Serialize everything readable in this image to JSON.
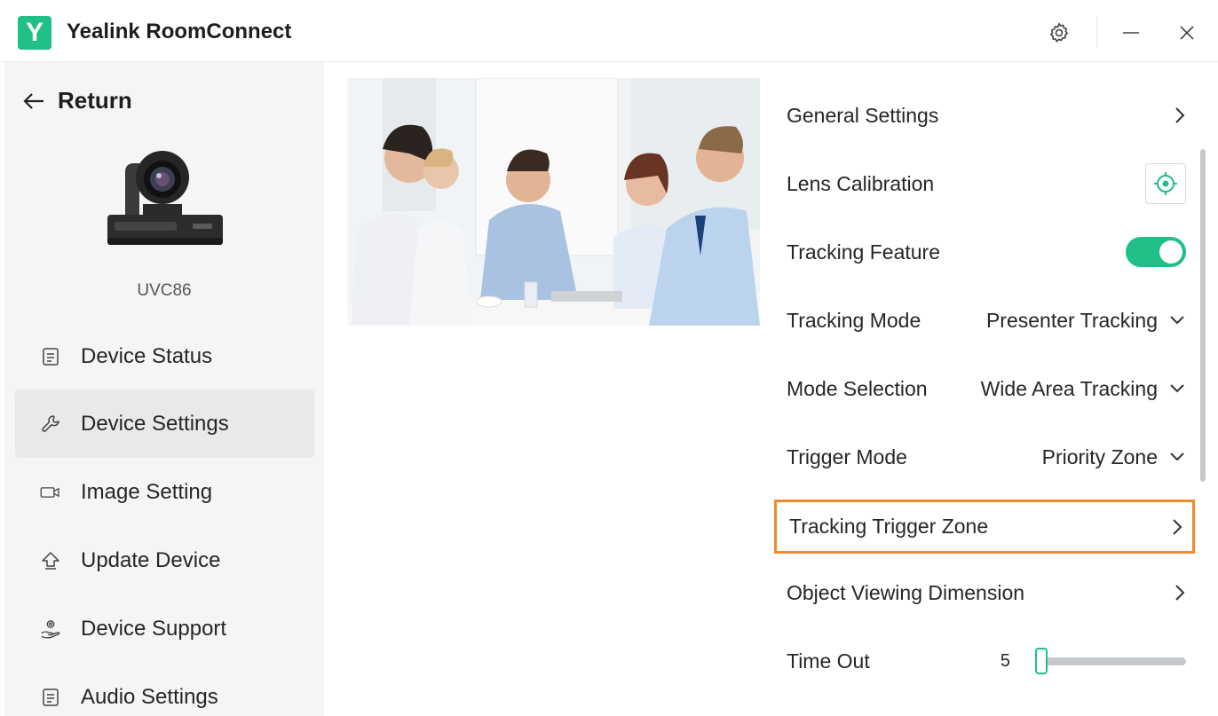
{
  "app": {
    "logo_letter": "Y",
    "title": "Yealink RoomConnect"
  },
  "titlebar": {
    "settings_icon": "gear-icon",
    "minimize_icon": "minimize-icon",
    "close_icon": "close-icon"
  },
  "sidebar": {
    "return_label": "Return",
    "device_name": "UVC86",
    "items": [
      {
        "label": "Device Status",
        "icon": "document-icon",
        "active": false
      },
      {
        "label": "Device Settings",
        "icon": "wrench-icon",
        "active": true
      },
      {
        "label": "Image Setting",
        "icon": "camera-icon",
        "active": false
      },
      {
        "label": "Update Device",
        "icon": "upload-icon",
        "active": false
      },
      {
        "label": "Device Support",
        "icon": "support-icon",
        "active": false
      },
      {
        "label": "Audio Settings",
        "icon": "document-icon",
        "active": false
      }
    ]
  },
  "settings": {
    "general": {
      "label": "General Settings"
    },
    "lens": {
      "label": "Lens Calibration"
    },
    "tracking_feature": {
      "label": "Tracking Feature",
      "enabled": true
    },
    "tracking_mode": {
      "label": "Tracking Mode",
      "value": "Presenter Tracking"
    },
    "mode_selection": {
      "label": "Mode Selection",
      "value": "Wide Area Tracking"
    },
    "trigger_mode": {
      "label": "Trigger Mode",
      "value": "Priority Zone"
    },
    "trigger_zone": {
      "label": "Tracking Trigger Zone"
    },
    "object_dimension": {
      "label": "Object Viewing Dimension"
    },
    "timeout": {
      "label": "Time Out",
      "value": "5",
      "slider_fraction": 0.0
    }
  },
  "colors": {
    "accent": "#1fbf86",
    "highlight": "#f08a2b"
  }
}
